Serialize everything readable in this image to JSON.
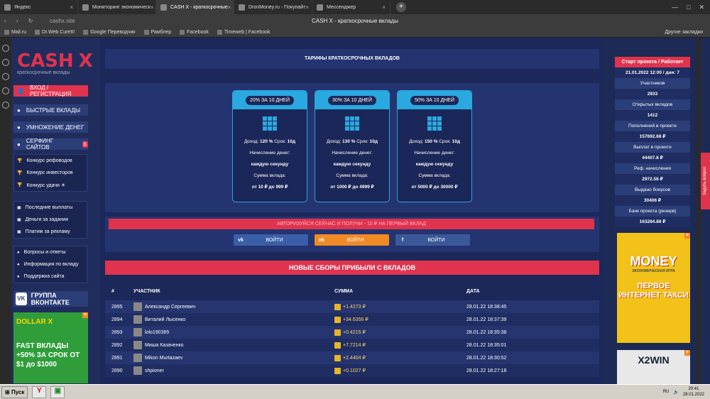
{
  "browser": {
    "tabs": [
      {
        "label": "Яндекс",
        "active": false
      },
      {
        "label": "Мониторинг экономическ",
        "active": false
      },
      {
        "label": "CASH X - краткосрочные",
        "active": true
      },
      {
        "label": "DronMoney.ru - Покупайт",
        "active": false
      },
      {
        "label": "Мессенджер",
        "active": false
      }
    ],
    "url": "cashx.site",
    "page_title": "CASH X - краткосрочные вклады",
    "bookmarks": [
      "Mail.ru",
      "Dr.Web CureIt!",
      "Google Переводчик",
      "Рамблер",
      "Facebook",
      "Timeweb | Facebook"
    ],
    "other_bookmarks": "Другие закладки"
  },
  "sidebar": {
    "logo": {
      "main": "CASH",
      "accent": "X",
      "sub": "краткосрочные вклады"
    },
    "login_label": "ВХОД / РЕГИСТРАЦИЯ",
    "menu": [
      {
        "label": "БЫСТРЫЕ ВКЛАДЫ"
      },
      {
        "label": "УМНОЖЕНИЕ ДЕНЕГ"
      },
      {
        "label": "СЕРФИНГ САЙТОВ",
        "badge": "6"
      }
    ],
    "contests": [
      "Конкурс рефоводов",
      "Конкурс инвесторов",
      "Конкурс удачи ☀"
    ],
    "links": [
      "Последние выплаты",
      "Деньги за задания",
      "Платим за рекламу"
    ],
    "info": [
      "Вопросы и ответы",
      "Информация по вкладу",
      "Поддержка сайта"
    ],
    "vk_label": "ГРУППА ВКОНТАКТЕ",
    "ad": {
      "brand": "DOLLAR X",
      "text": "FAST ВКЛАДЫ +50% ЗА СРОК ОТ $1 до $1000"
    }
  },
  "main": {
    "tariffs_title": "ТАРИФЫ КРАТКОСРОЧНЫХ ВКЛАДОВ",
    "plans": [
      {
        "badge": "20% ЗА 10 ДНЕЙ",
        "income_label": "Доход:",
        "income": "120 %",
        "term_label": "Срок:",
        "term": "10д",
        "accrual_label": "Начисление денег:",
        "accrual": "каждую секунду",
        "sum_label": "Сумма вклада:",
        "sum": "от 10 ₽ до 999 ₽"
      },
      {
        "badge": "30% ЗА 10 ДНЕЙ",
        "income_label": "Доход:",
        "income": "130 %",
        "term_label": "Срок:",
        "term": "10д",
        "accrual_label": "Начисление денег:",
        "accrual": "каждую секунду",
        "sum_label": "Сумма вклада:",
        "sum": "от 1000 ₽ до 4999 ₽"
      },
      {
        "badge": "50% ЗА 10 ДНЕЙ",
        "income_label": "Доход:",
        "income": "150 %",
        "term_label": "Срок:",
        "term": "10д",
        "accrual_label": "Начисление денег:",
        "accrual": "каждую секунду",
        "sum_label": "Сумма вклада:",
        "sum": "от 5000 ₽ до 30000 ₽"
      }
    ],
    "register_banner": "АВТОРИЗУЙСЯ СЕЙЧАС И ПОЛУЧИ - 10 ₽ НА ПЕРВЫЙ ВКЛАД",
    "social": [
      {
        "icon": "vk-icon",
        "glyph": "vk",
        "label": "ВОЙТИ",
        "color": "#3a5fa8"
      },
      {
        "icon": "odnoklassniki-icon",
        "glyph": "ok",
        "label": "ВОЙТИ",
        "color": "#f08a24"
      },
      {
        "icon": "facebook-icon",
        "glyph": "f",
        "label": "ВОЙТИ",
        "color": "#3b5998"
      }
    ],
    "new_title": "НОВЫЕ СБОРЫ ПРИБЫЛИ С ВКЛАДОВ",
    "table": {
      "headers": [
        "#",
        "УЧАСТНИК",
        "СУММА",
        "ДАТА"
      ],
      "rows": [
        {
          "id": "2895",
          "name": "Александр Сергеевич",
          "amount": "+1.4273 ₽",
          "date": "28.01.22 18:38:45"
        },
        {
          "id": "2894",
          "name": "Виталий Лысенко",
          "amount": "+34.6356 ₽",
          "date": "28.01.22 18:37:39"
        },
        {
          "id": "2893",
          "name": "lolo190365",
          "amount": "+0.4215 ₽",
          "date": "28.01.22 18:35:38"
        },
        {
          "id": "2892",
          "name": "Миша Казаченко",
          "amount": "+7.7214 ₽",
          "date": "28.01.22 18:35:01"
        },
        {
          "id": "2891",
          "name": "Mikon Murtazaev",
          "amount": "+2.4404 ₽",
          "date": "28.01.22 18:30:52"
        },
        {
          "id": "2890",
          "name": "shpioner",
          "amount": "+0.1027 ₽",
          "date": "28.01.22 18:27:18"
        }
      ]
    }
  },
  "stats": {
    "header": "Старт проекта / Работает",
    "start": "21.01.2022 12:00 / дни: 7",
    "items": [
      {
        "label": "Участников",
        "value": "2933"
      },
      {
        "label": "Открытых вкладов",
        "value": "1412"
      },
      {
        "label": "Пополнений в проекте",
        "value": "157692.68 ₽"
      },
      {
        "label": "Выплат в проекте",
        "value": "44407.8 ₽"
      },
      {
        "label": "Реф. начисления",
        "value": "2972.58 ₽"
      },
      {
        "label": "Выдано бонусов",
        "value": "30406 ₽"
      },
      {
        "label": "Банк проекта (резерв)",
        "value": "163284.88 ₽"
      }
    ],
    "ad1": {
      "brand": "MONEY",
      "sub": "ЭКОНОМИЧЕСКАЯ ИГРА",
      "text": "ПЕРВОЕ ИНТЕРНЕТ ТАКСИ"
    },
    "ad2": {
      "brand": "X2WIN"
    }
  },
  "ask_question": "Задать вопрос",
  "taskbar": {
    "start": "Пуск",
    "time": "20:41",
    "date": "28.01.2022",
    "lang": "RU"
  }
}
